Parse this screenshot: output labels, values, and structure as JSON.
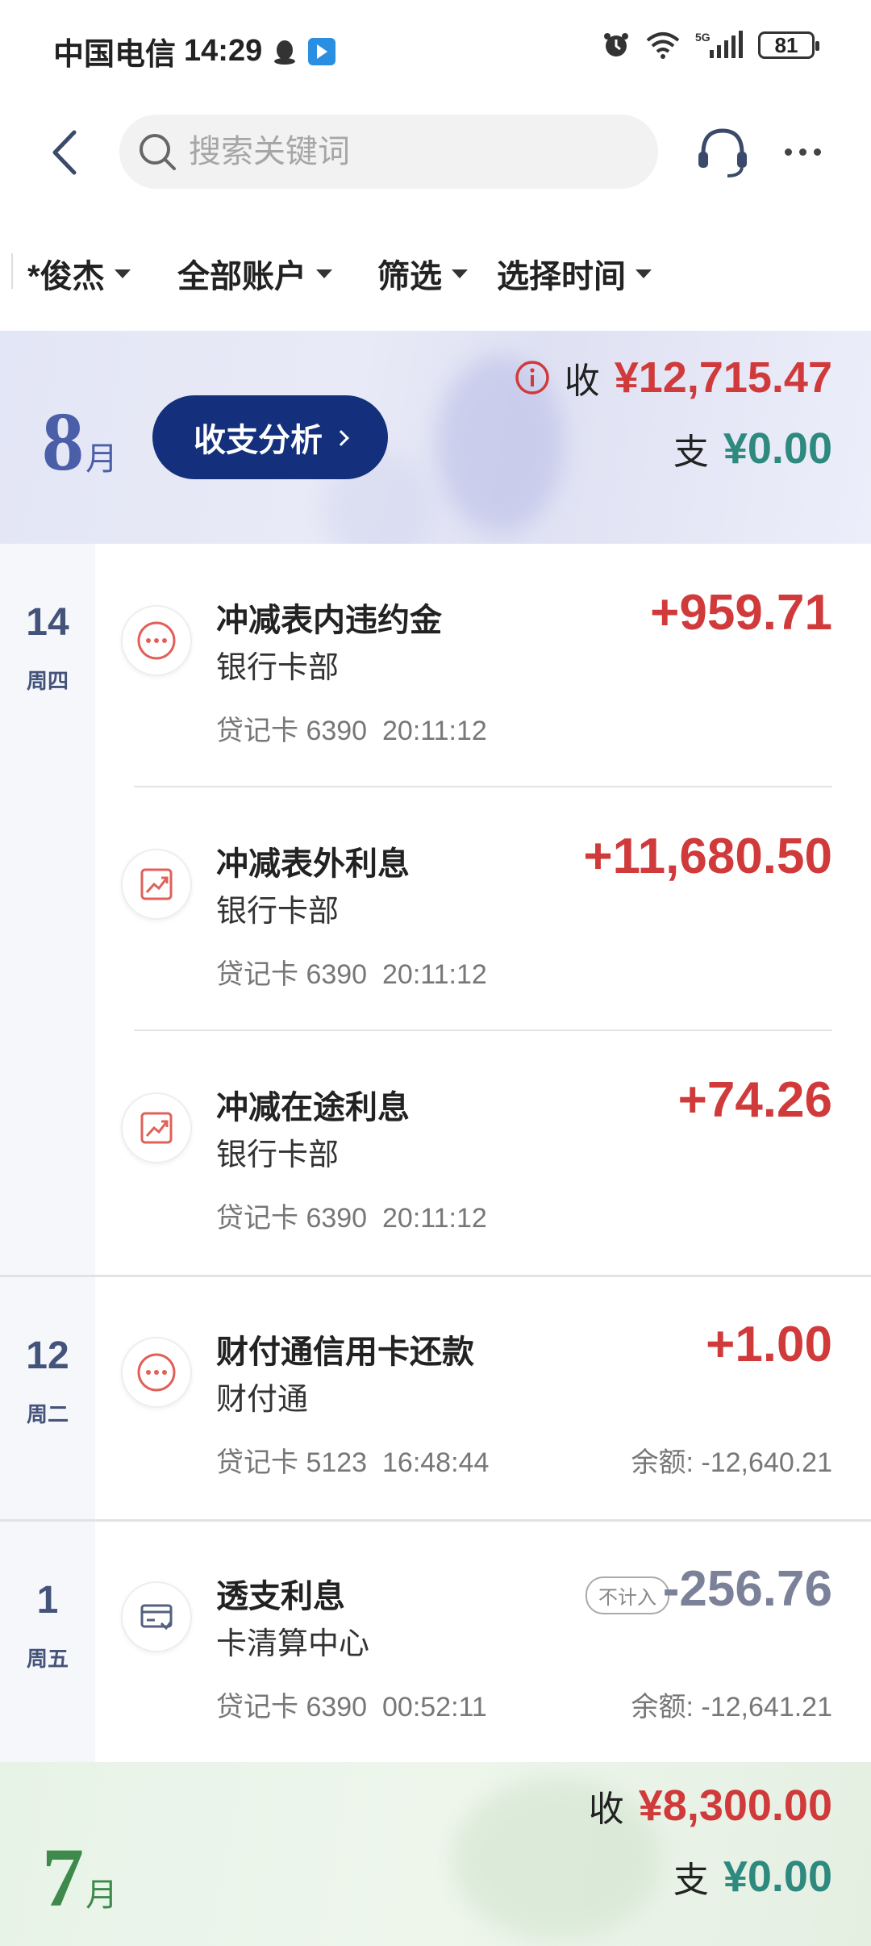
{
  "status_bar": {
    "carrier": "中国电信",
    "time": "14:29",
    "battery": "81"
  },
  "header": {
    "search_placeholder": "搜索关键词"
  },
  "filters": [
    {
      "label": "*俊杰"
    },
    {
      "label": "全部账户"
    },
    {
      "label": "筛选"
    },
    {
      "label": "选择时间"
    }
  ],
  "months": [
    {
      "month": "8",
      "suffix": "月",
      "analysis_label": "收支分析",
      "income_label": "收",
      "income_amount": "¥12,715.47",
      "expense_label": "支",
      "expense_amount": "¥0.00"
    },
    {
      "month": "7",
      "suffix": "月",
      "income_label": "收",
      "income_amount": "¥8,300.00",
      "expense_label": "支",
      "expense_amount": "¥0.00"
    }
  ],
  "groups": [
    {
      "day": "14",
      "weekday": "周四",
      "transactions": [
        {
          "title": "冲减表内违约金",
          "sub": "银行卡部",
          "card": "贷记卡 6390",
          "time": "20:11:12",
          "amount": "+959.71",
          "icon": "more-circle-icon"
        },
        {
          "title": "冲减表外利息",
          "sub": "银行卡部",
          "card": "贷记卡 6390",
          "time": "20:11:12",
          "amount": "+11,680.50",
          "icon": "trend-chart-icon"
        },
        {
          "title": "冲减在途利息",
          "sub": "银行卡部",
          "card": "贷记卡 6390",
          "time": "20:11:12",
          "amount": "+74.26",
          "icon": "trend-chart-icon"
        }
      ]
    },
    {
      "day": "12",
      "weekday": "周二",
      "transactions": [
        {
          "title": "财付通信用卡还款",
          "sub": "财付通",
          "card": "贷记卡 5123",
          "time": "16:48:44",
          "amount": "+1.00",
          "balance": "余额: -12,640.21",
          "icon": "more-circle-icon"
        }
      ]
    },
    {
      "day": "1",
      "weekday": "周五",
      "transactions": [
        {
          "title": "透支利息",
          "sub": "卡清算中心",
          "card": "贷记卡 6390",
          "time": "00:52:11",
          "amount": "-256.76",
          "balance": "余额: -12,641.21",
          "badge": "不计入",
          "icon": "card-icon"
        }
      ]
    }
  ],
  "colors": {
    "income": "#d03a3a",
    "expense": "#2e8a7e",
    "excluded": "#7b8199",
    "accent_button": "#142f7c"
  }
}
